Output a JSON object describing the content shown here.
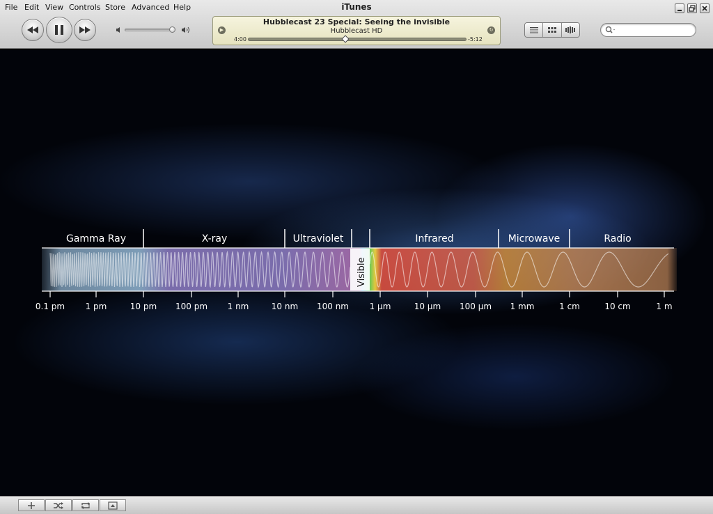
{
  "window": {
    "title": "iTunes"
  },
  "menu": [
    "File",
    "Edit",
    "View",
    "Controls",
    "Store",
    "Advanced",
    "Help"
  ],
  "transport": {
    "prev_icon": "rewind-icon",
    "play_icon": "pause-icon",
    "next_icon": "fast-forward-icon",
    "volume_level": 0.95
  },
  "now_playing": {
    "title": "Hubblecast 23 Special: Seeing the invisible",
    "artist": "Hubblecast HD",
    "elapsed": "4:00",
    "remaining": "-5:12",
    "progress": 0.43
  },
  "view_buttons": [
    "list-view-icon",
    "grid-view-icon",
    "cover-flow-icon"
  ],
  "search": {
    "placeholder": "",
    "value": ""
  },
  "video": {
    "bands": [
      "Gamma Ray",
      "X-ray",
      "Ultraviolet",
      "Visible",
      "Infrared",
      "Microwave",
      "Radio"
    ],
    "ticks": [
      "0.1 pm",
      "1 pm",
      "10 pm",
      "100 pm",
      "1 nm",
      "10 nm",
      "100 nm",
      "1 µm",
      "10 µm",
      "100 µm",
      "1 mm",
      "1 cm",
      "10 cm",
      "1 m"
    ]
  },
  "bottom_buttons": [
    "add-playlist-icon",
    "shuffle-icon",
    "repeat-icon",
    "show-artwork-icon"
  ],
  "colors": {
    "gamma": "#8fb2cf",
    "xray": "#8a7ac0",
    "uv": "#b070b0",
    "infrared": "#d0604a",
    "microwave": "#c8883a",
    "radio": "#b88055"
  }
}
